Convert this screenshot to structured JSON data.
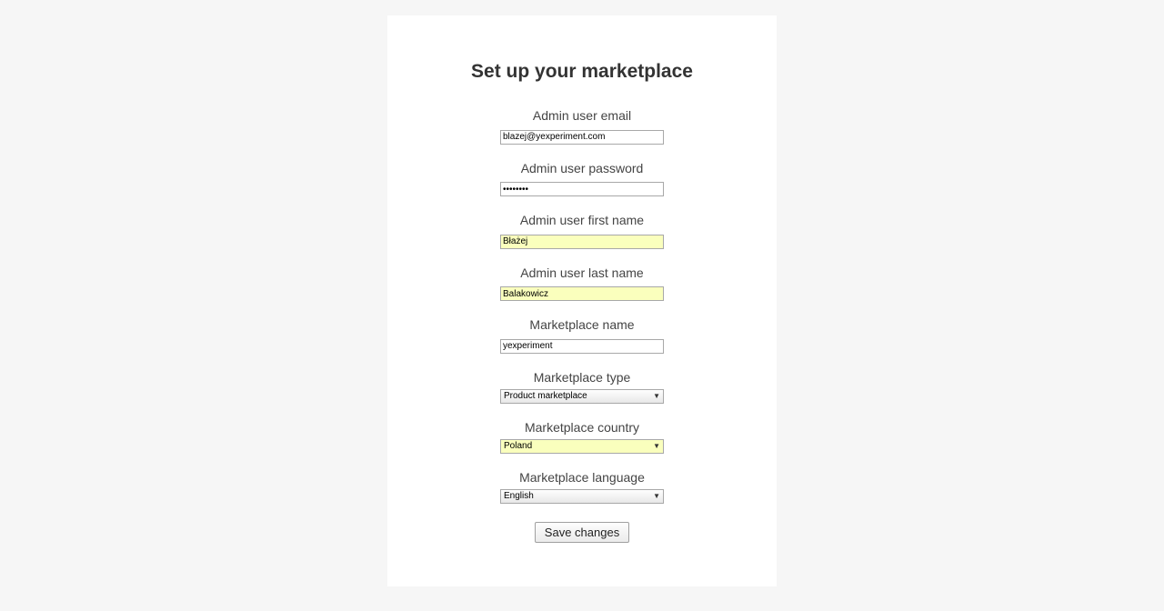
{
  "page": {
    "title": "Set up your marketplace"
  },
  "form": {
    "email": {
      "label": "Admin user email",
      "value": "blazej@yexperiment.com"
    },
    "password": {
      "label": "Admin user password",
      "value": "••••••••"
    },
    "first_name": {
      "label": "Admin user first name",
      "value": "Błażej"
    },
    "last_name": {
      "label": "Admin user last name",
      "value": "Balakowicz"
    },
    "marketplace_name": {
      "label": "Marketplace name",
      "value": "yexperiment"
    },
    "marketplace_type": {
      "label": "Marketplace type",
      "selected": "Product marketplace"
    },
    "marketplace_country": {
      "label": "Marketplace country",
      "selected": "Poland"
    },
    "marketplace_language": {
      "label": "Marketplace language",
      "selected": "English"
    },
    "submit_label": "Save changes"
  }
}
